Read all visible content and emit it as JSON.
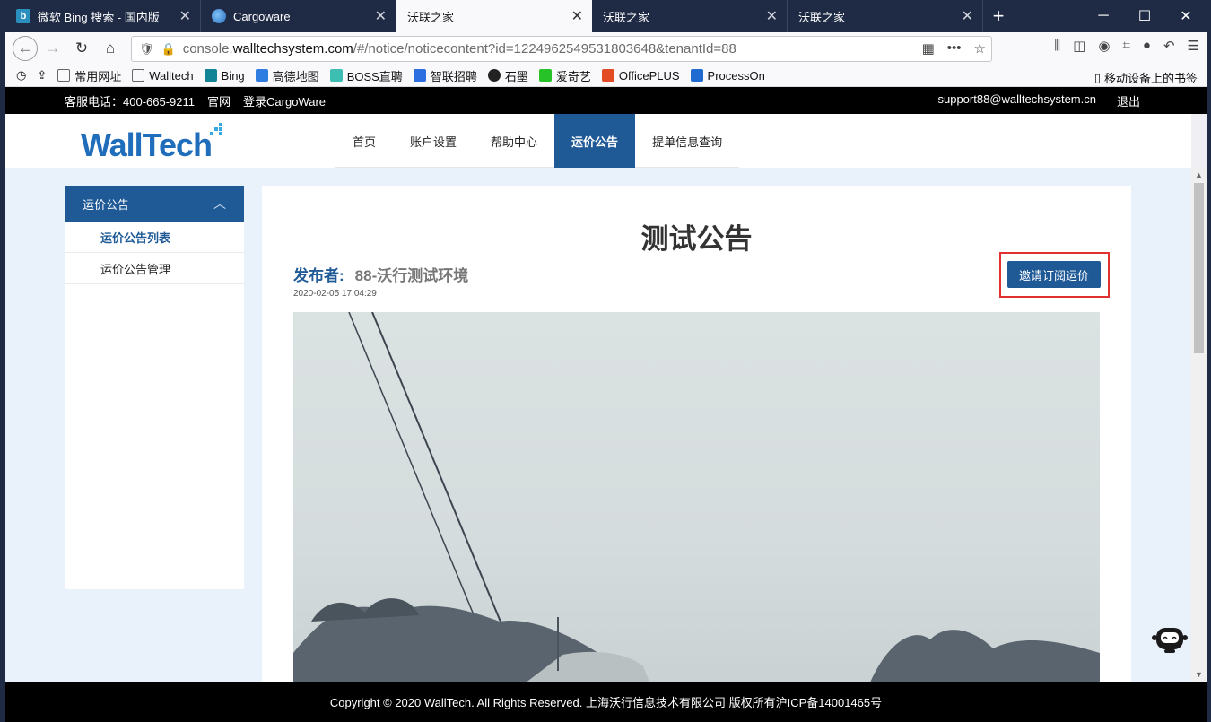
{
  "tabs": [
    {
      "label": "微软 Bing 搜索 - 国内版",
      "favicon_color": "#2a8fbd"
    },
    {
      "label": "Cargoware",
      "favicon_color": "#3a7fd0"
    },
    {
      "label": "沃联之家",
      "favicon_color": "#f9f9fb"
    },
    {
      "label": "沃联之家",
      "favicon_color": "#1f2a44"
    },
    {
      "label": "沃联之家",
      "favicon_color": "#1f2a44"
    }
  ],
  "new_tab_label": "+",
  "window_controls": {
    "minimize": "─",
    "maximize": "☐",
    "close": "✕"
  },
  "address": {
    "prefix": "console.",
    "domain": "walltechsystem.com",
    "path": "/#/notice/noticecontent?id=1224962549531803648&tenantId=88"
  },
  "bookmarks": [
    {
      "label": "常用网址",
      "color": "#888"
    },
    {
      "label": "Walltech",
      "color": "#888"
    },
    {
      "label": "Bing",
      "color": "#138496"
    },
    {
      "label": "高德地图",
      "color": "#2f7de1"
    },
    {
      "label": "BOSS直聘",
      "color": "#3cbfb2"
    },
    {
      "label": "智联招聘",
      "color": "#2d6ee0"
    },
    {
      "label": "石墨",
      "color": "#222"
    },
    {
      "label": "爱奇艺",
      "color": "#27c227"
    },
    {
      "label": "OfficePLUS",
      "color": "#e34d26"
    },
    {
      "label": "ProcessOn",
      "color": "#1f6bd1"
    }
  ],
  "mobile_bookmarks": "移动设备上的书签",
  "topbar": {
    "phone": "客服电话：400-665-9211",
    "official": "官网",
    "login": "登录CargoWare",
    "email": "support88@walltechsystem.cn",
    "logout": "退出"
  },
  "logo_text": "WallTech",
  "menu": [
    "首页",
    "账户设置",
    "帮助中心",
    "运价公告",
    "提单信息查询"
  ],
  "active_menu_index": 3,
  "sidebar": {
    "header": "运价公告",
    "items": [
      "运价公告列表",
      "运价公告管理"
    ]
  },
  "notice": {
    "title": "测试公告",
    "publisher_label": "发布者:",
    "publisher": "88-沃行测试环境",
    "date": "2020-02-05 17:04:29",
    "invite_button": "邀请订阅运价"
  },
  "footer": "Copyright © 2020 WallTech. All Rights Reserved. 上海沃行信息技术有限公司 版权所有沪ICP备14001465号",
  "accent_color": "#1f5a97",
  "highlight_color": "#e03030"
}
